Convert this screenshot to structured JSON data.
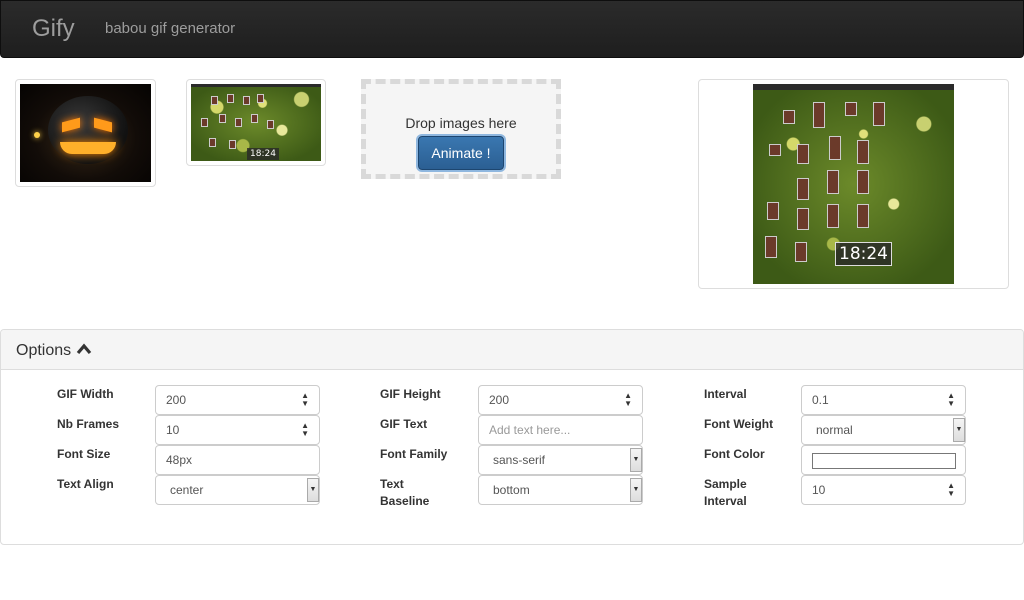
{
  "navbar": {
    "brand": "Gify",
    "subtitle": "babou gif generator"
  },
  "images": {
    "thumbnails": [
      {
        "icon": "pumpkin-image"
      },
      {
        "icon": "desktop-screenshot-image",
        "clock": "18:24"
      }
    ],
    "preview": {
      "icon": "animated-gif-preview",
      "clock": "18:24"
    }
  },
  "dropzone": {
    "text": "Drop images here",
    "button_label": "Animate !"
  },
  "options": {
    "title": "Options",
    "gif_width": {
      "label": "GIF Width",
      "value": "200"
    },
    "gif_height": {
      "label": "GIF Height",
      "value": "200"
    },
    "interval": {
      "label": "Interval",
      "value": "0.1"
    },
    "nb_frames": {
      "label": "Nb Frames",
      "value": "10"
    },
    "gif_text": {
      "label": "GIF Text",
      "placeholder": "Add text here..."
    },
    "font_weight": {
      "label": "Font Weight",
      "value": "normal"
    },
    "font_size": {
      "label": "Font Size",
      "value": "48px"
    },
    "font_family": {
      "label": "Font Family",
      "value": "sans-serif"
    },
    "font_color": {
      "label": "Font Color",
      "value": "#ffffff"
    },
    "text_align": {
      "label": "Text Align",
      "value": "center"
    },
    "text_baseline": {
      "label_line1": "Text",
      "label_line2": "Baseline",
      "value": "bottom"
    },
    "sample_interval": {
      "label_line1": "Sample",
      "label_line2": "Interval",
      "value": "10"
    }
  }
}
